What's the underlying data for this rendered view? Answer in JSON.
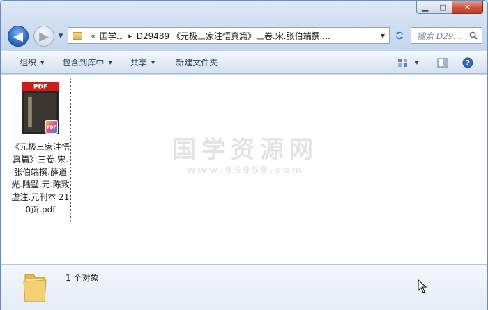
{
  "window": {
    "minimize_label": "▁",
    "maximize_label": "□",
    "close_label": "✕"
  },
  "nav": {
    "back_glyph": "◀",
    "forward_glyph": "▶",
    "history_glyph": "▼"
  },
  "address": {
    "overflow": "«",
    "segments": [
      "国学...",
      "D29489 《元极三家注悟真篇》三卷.宋.张伯端撰...."
    ],
    "separator": "▸",
    "dropdown_glyph": "▼"
  },
  "search": {
    "placeholder": "搜索 D29..."
  },
  "toolbar": {
    "organize": "组织",
    "include_library": "包含到库中",
    "share": "共享",
    "new_folder": "新建文件夹",
    "caret": "▼"
  },
  "file": {
    "thumb_badge": "PDF",
    "name": "《元极三家注悟真篇》三卷.宋.张伯端撰.薛道光.陆墅.元.陈致虚注.元刊本 210页.pdf"
  },
  "watermark": {
    "title": "国学资源网",
    "url": "www.95959.com"
  },
  "details": {
    "count_text": "1 个对象"
  },
  "colors": {
    "accent": "#2c6cc4",
    "pdf_red": "#c8201c",
    "close_red": "#c03e22"
  }
}
